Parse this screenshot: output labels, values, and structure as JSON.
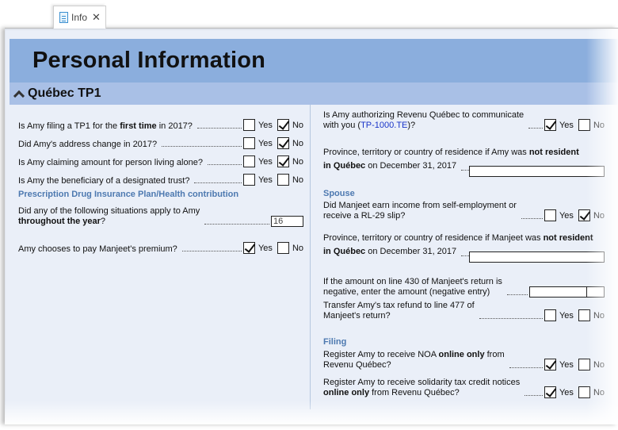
{
  "tab": {
    "icon": "document-icon",
    "label": "Info",
    "close_icon": "close-icon"
  },
  "title": "Personal Information",
  "section": {
    "label": "Québec TP1",
    "icon": "chevron-up-icon"
  },
  "labels": {
    "yes": "Yes",
    "no": "No"
  },
  "left": {
    "questions": [
      {
        "parts": [
          "Is Amy filing a TP1 for the ",
          "first time",
          " in 2017?"
        ],
        "yes": false,
        "no": true
      },
      {
        "text": "Did Amy's address change in 2017?",
        "yes": false,
        "no": true
      },
      {
        "text": "Is Amy claiming amount for person living alone?",
        "yes": false,
        "no": true
      },
      {
        "text": "Is Amy the beneficiary of a designated trust?",
        "yes": false,
        "no": false
      }
    ],
    "drug_heading": "Prescription Drug Insurance Plan/Health contribution",
    "situations": {
      "line1": "Did any of the following situations apply to Amy",
      "line2_bold": "throughout the year",
      "line2_end": "?",
      "value": "16"
    },
    "premium": {
      "text": "Amy chooses to pay Manjeet's premium?",
      "yes": true,
      "no": false
    }
  },
  "right": {
    "authorize": {
      "line1": "Is Amy authorizing Revenu Québec to communicate",
      "line2_a": "with you (",
      "link": "TP-1000.TE",
      "line2_b": ")?",
      "yes": true,
      "no": false
    },
    "amy_residence": {
      "line1_a": "Province, territory or country of residence if Amy was ",
      "line1_b": "not resident",
      "line2_a": "in Québec",
      "line2_b": " on December 31, 2017",
      "value": ""
    },
    "spouse_heading": "Spouse",
    "self_employment": {
      "line1": "Did Manjeet earn income from self-employment or",
      "line2": "receive a RL-29 slip?",
      "yes": false,
      "no": true
    },
    "manjeet_residence": {
      "line1_a": "Province, territory or country of residence if Manjeet was ",
      "line1_b": "not resident",
      "line2_a": "in Québec",
      "line2_b": " on December 31, 2017",
      "value": ""
    },
    "line430": {
      "line1": "If the amount on line 430 of Manjeet's return is",
      "line2": "negative, enter the amount (negative entry)",
      "value": ""
    },
    "transfer": {
      "line1": "Transfer Amy's tax refund to line 477 of",
      "line2": "Manjeet's return?",
      "yes": false,
      "no": false
    },
    "filing_heading": "Filing",
    "noa": {
      "line1_a": "Register Amy to receive NOA ",
      "line1_b": "online only",
      "line1_c": " from",
      "line2": "Revenu Québec?",
      "yes": true,
      "no": false
    },
    "solidarity": {
      "line1": "Register Amy to receive solidarity tax credit notices",
      "line2_a": "online only",
      "line2_b": " from Revenu Québec?",
      "yes": true,
      "no": false
    }
  }
}
